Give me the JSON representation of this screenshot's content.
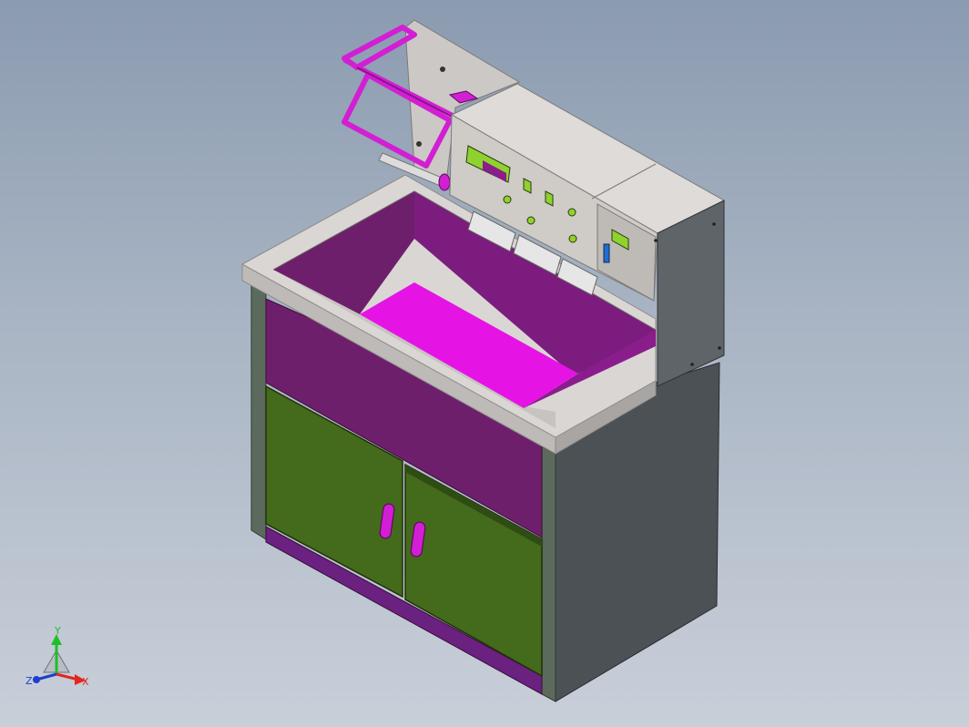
{
  "viewport": {
    "background_top": "#8b9bb0",
    "background_bottom": "#c9cfd9"
  },
  "model": {
    "colors": {
      "frame_light": "#d9d6d3",
      "frame_edge": "#9b9896",
      "side_panel": "#4b5155",
      "inner_wall": "#6e1f6c",
      "inner_back": "#7b1c7e",
      "basin_floor": "#e514e5",
      "door_green": "#446a1c",
      "door_dark": "#2f4c14",
      "gap_purple": "#5a2066",
      "handle_magenta": "#d21fd4",
      "control_panel": "#d6d2cd",
      "indicator_green": "#8fd12e"
    },
    "icons": [
      "cabinet-model",
      "control-box",
      "rollers",
      "lid-frame",
      "door-handle"
    ]
  },
  "triad": {
    "y_label": "Y",
    "x_label": "X",
    "z_label": "Z",
    "y_color": "#1fbf2a",
    "x_color": "#e0281f",
    "z_color": "#1e3fd0"
  }
}
